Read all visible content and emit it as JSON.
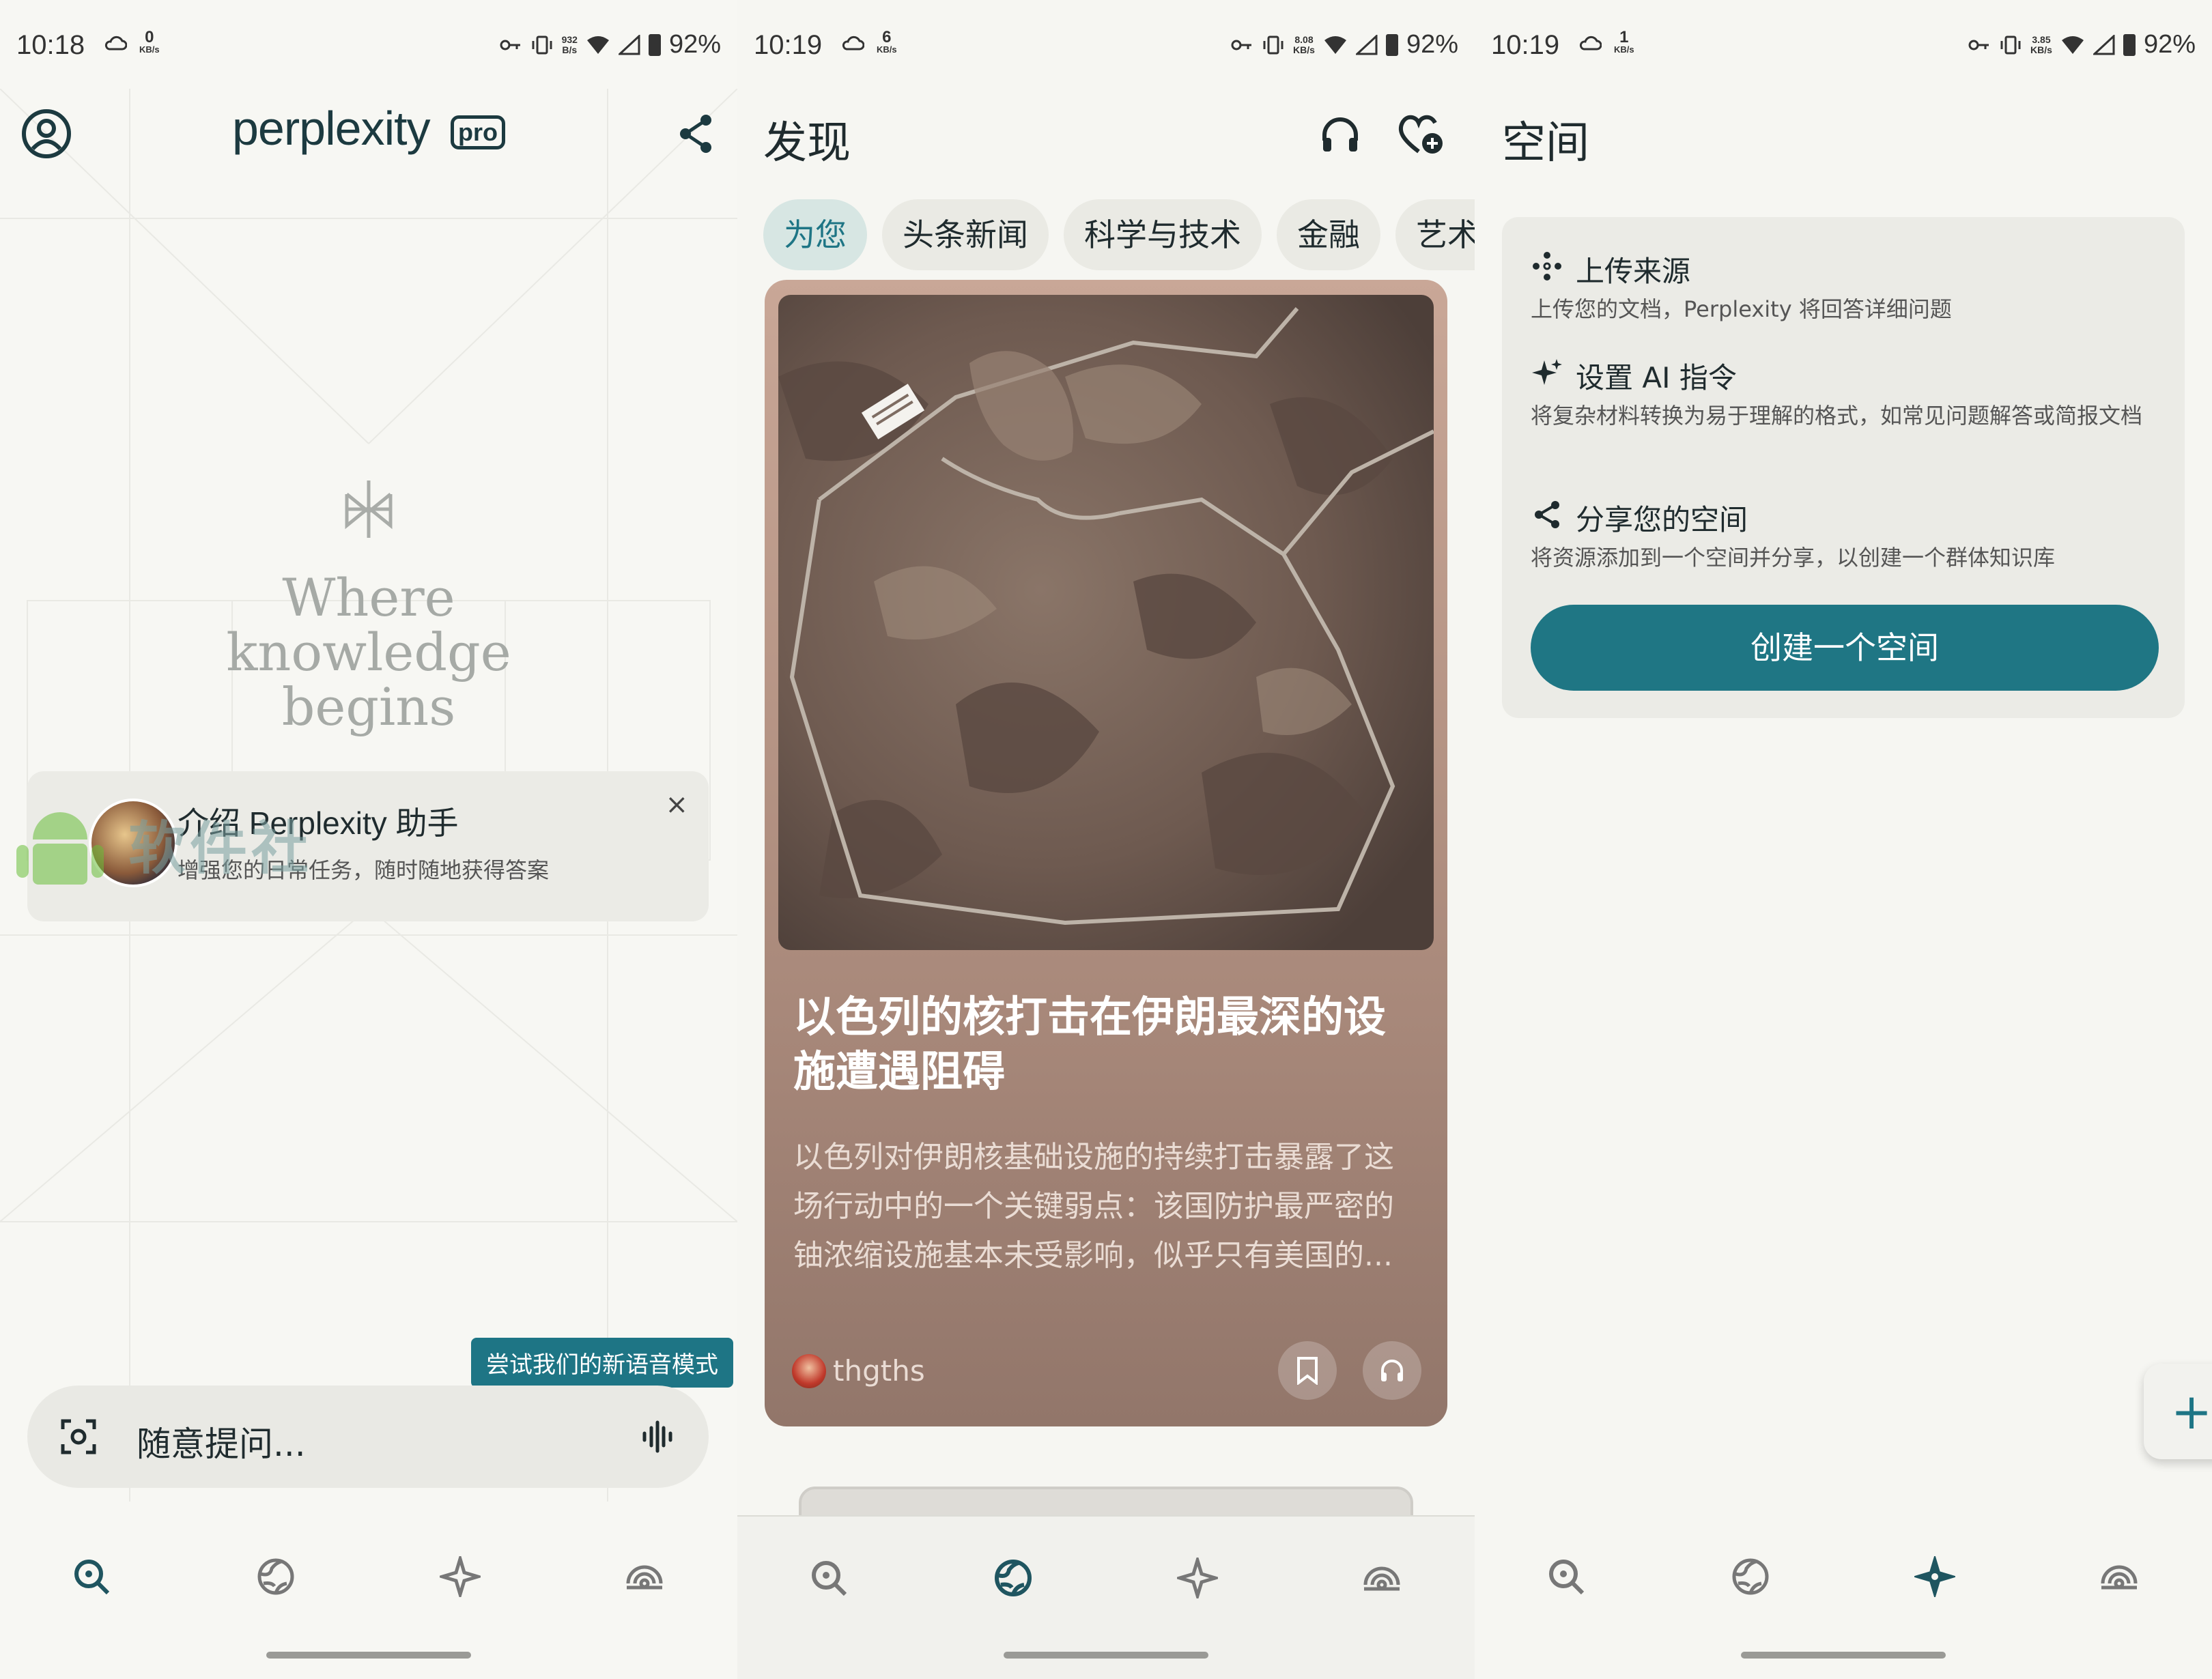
{
  "status_bars": [
    {
      "time": "10:18",
      "net_speed": "0",
      "net_unit": "KB/s",
      "right_speed": "932",
      "right_unit": "B/s",
      "battery": "92%"
    },
    {
      "time": "10:19",
      "net_speed": "6",
      "net_unit": "KB/s",
      "right_speed": "8.08",
      "right_unit": "KB/s",
      "battery": "92%"
    },
    {
      "time": "10:19",
      "net_speed": "1",
      "net_unit": "KB/s",
      "right_speed": "3.85",
      "right_unit": "KB/s",
      "battery": "92%"
    }
  ],
  "home": {
    "logo": "perplexity",
    "pro_badge": "pro",
    "tagline_lines": [
      "Where",
      "knowledge",
      "begins"
    ],
    "assistant_card": {
      "title": "介绍 Perplexity 助手",
      "subtitle": "增强您的日常任务，随时随地获得答案",
      "close": "×"
    },
    "watermark": "软件社",
    "voice_tip": "尝试我们的新语音模式",
    "ask_placeholder": "随意提问..."
  },
  "discover": {
    "title": "发现",
    "chips": [
      "为您",
      "头条新闻",
      "科学与技术",
      "金融",
      "艺术与"
    ],
    "active_chip": 0,
    "article": {
      "title": "以色列的核打击在伊朗最深的设施遭遇阻碍",
      "body": "以色列对伊朗核基础设施的持续打击暴露了这场行动中的一个关键弱点：该国防护最严密的铀浓缩设施基本未受影响，似乎只有美国的...",
      "author": "thgths"
    }
  },
  "spaces": {
    "title": "空间",
    "features": [
      {
        "icon": "upload-sources-icon",
        "title": "上传来源",
        "subtitle": "上传您的文档，Perplexity 将回答详细问题"
      },
      {
        "icon": "ai-sparkle-icon",
        "title": "设置 AI 指令",
        "subtitle": "将复杂材料转换为易于理解的格式，如常见问题解答或简报文档"
      },
      {
        "icon": "share-icon",
        "title": "分享您的空间",
        "subtitle": "将资源添加到一个空间并分享，以创建一个群体知识库"
      }
    ],
    "create_button": "创建一个空间",
    "fab": "+"
  },
  "nav": {
    "items": [
      "search-icon",
      "discover-globe-icon",
      "spaces-sparkle-icon",
      "library-icon"
    ],
    "active_per_panel": [
      0,
      1,
      2
    ]
  },
  "colors": {
    "accent": "#1e7585",
    "text_dark": "#1f2b2e",
    "card_bg": "#ebebe6"
  }
}
